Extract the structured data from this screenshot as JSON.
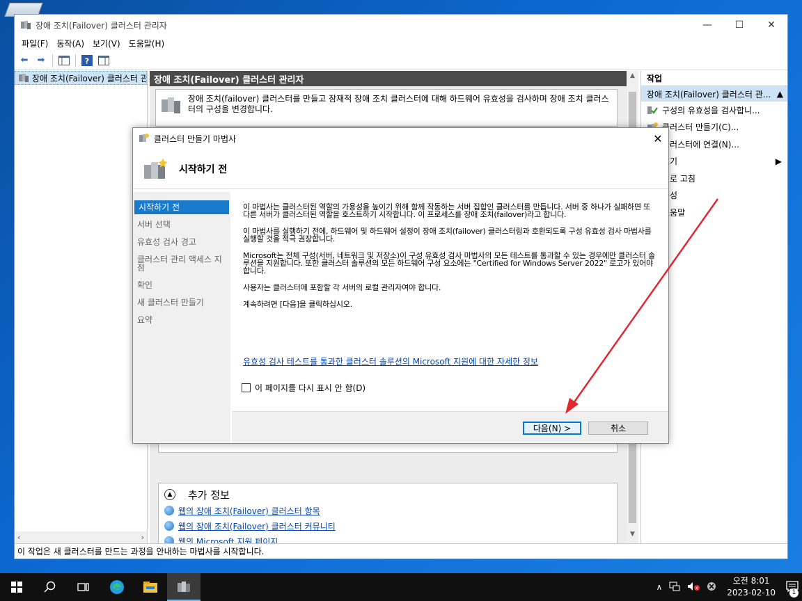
{
  "window": {
    "title": "장애 조치(Failover) 클러스터 관리자",
    "minimize": "—",
    "maximize": "☐",
    "close": "✕"
  },
  "menu": [
    "파일(F)",
    "동작(A)",
    "보기(V)",
    "도움말(H)"
  ],
  "tree": {
    "root_label": "장애 조치(Failover) 클러스터 관"
  },
  "center": {
    "header": "장애 조치(Failover) 클러스터 관리자",
    "description": "장애 조치(failover) 클러스터를 만들고 잠재적 장애 조치 클러스터에 대해 하드웨어 유효성을 검사하며 장애 조치 클러스터의 구성을 변경합니다.",
    "more_info_title": "추가 정보",
    "more_info_links": [
      "웹의 장애 조치(Failover) 클러스터 항목",
      "웹의 장애 조치(Failover) 클러스터 커뮤니티",
      "웹의 Microsoft 지원 페이지"
    ]
  },
  "actions": {
    "header": "작업",
    "subheader": "장애 조치(Failover) 클러스터 관...",
    "items": [
      "구성의 유효성을 검사합니...",
      "클러스터 만들기(C)...",
      "클러스터에 연결(N)...",
      "보기",
      "새로 고침",
      "속성",
      "도움말"
    ]
  },
  "status_text": "이 작업은 새 클러스터를 만드는 과정을 안내하는 마법사를 시작합니다.",
  "wizard": {
    "title": "클러스터 만들기 마법사",
    "heading": "시작하기 전",
    "steps": [
      "시작하기 전",
      "서버 선택",
      "유효성 검사 경고",
      "클러스터 관리 액세스 지점",
      "확인",
      "새 클러스터 만들기",
      "요약"
    ],
    "paragraphs": [
      "이 마법사는 클러스터된 역할의 가용성을 높이기 위해 함께 작동하는 서버 집합인 클러스터를 만듭니다. 서버 중 하나가 실패하면 또 다른 서버가 클러스터된 역할을 호스트하기 시작합니다. 이 프로세스를 장애 조치(failover)라고 합니다.",
      "이 마법사를 실행하기 전에, 하드웨어 및 하드웨어 설정이 장애 조치(failover) 클러스터링과 호환되도록 구성 유효성 검사 마법사를 실행할 것을 적극 권장합니다.",
      "Microsoft는 전체 구성(서버, 네트워크 및 저장소)이 구성 유효성 검사 마법사의 모든 테스트를 통과할 수 있는 경우에만 클러스터 솔루션을 지원합니다. 또한 클러스터 솔루션의 모든 하드웨어 구성 요소에는 \"Certified for Windows Server 2022\" 로고가 있어야 합니다.",
      "사용자는 클러스터에 포함할 각 서버의 로컬 관리자여야 합니다.",
      "계속하려면 [다음]을 클릭하십시오."
    ],
    "link": "유효성 검사 테스트를 통과한 클러스터 솔루션의 Microsoft 지원에 대한 자세한 정보",
    "checkbox_label": "이 페이지를 다시 표시 안 함(D)",
    "next_button": "다음(N) >",
    "cancel_button": "취소",
    "close": "✕"
  },
  "taskbar": {
    "clock_time": "오전 8:01",
    "clock_date": "2023-02-10",
    "notification_count": "1"
  },
  "colors": {
    "accent": "#0078d7",
    "annotation_arrow": "#e0282e",
    "header_dark": "#4b4b4b",
    "selection": "#1979ca"
  }
}
